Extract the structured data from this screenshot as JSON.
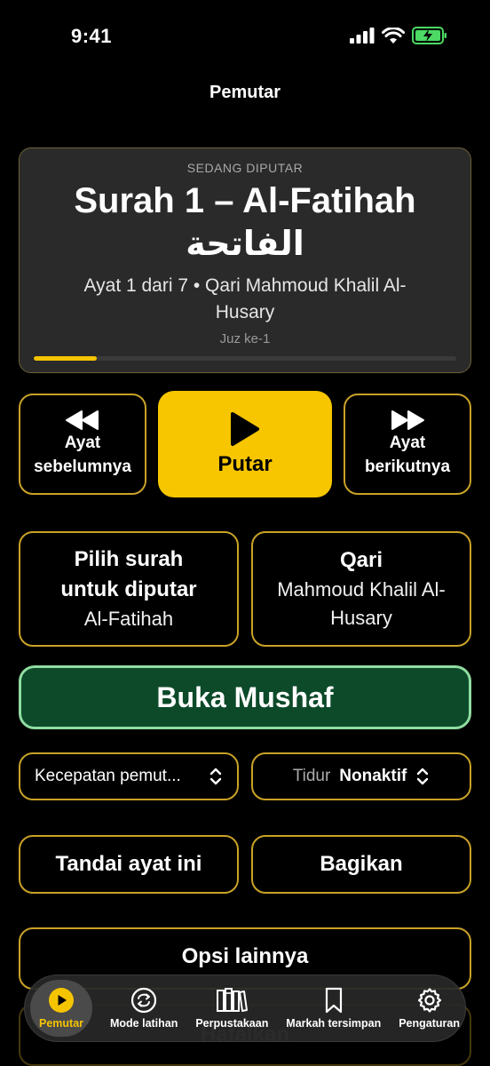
{
  "status": {
    "time": "9:41"
  },
  "nav": {
    "title": "Pemutar"
  },
  "now_playing": {
    "label": "SEDANG DIPUTAR",
    "title": "Surah 1 – Al-Fatihah",
    "arabic": "الفاتحة",
    "meta": "Ayat 1 dari 7  •  Qari Mahmoud Khalil Al-Husary",
    "juz": "Juz ke-1",
    "progress": 0.15
  },
  "controls": {
    "prev_line1": "Ayat",
    "prev_line2": "sebelumnya",
    "play": "Putar",
    "next_line1": "Ayat",
    "next_line2": "berikutnya"
  },
  "surah_picker": {
    "title_line1": "Pilih surah",
    "title_line2": "untuk diputar",
    "value": "Al-Fatihah"
  },
  "qari_picker": {
    "title": "Qari",
    "value": "Mahmoud Khalil Al-Husary"
  },
  "mushaf_button": "Buka Mushaf",
  "speed_select": {
    "value": "Kecepatan pemut..."
  },
  "sleep_select": {
    "label": "Tidur",
    "value": "Nonaktif"
  },
  "actions": {
    "bookmark": "Tandai ayat ini",
    "share": "Bagikan",
    "more": "Opsi lainnya",
    "hidden": "Hafalkan"
  },
  "tabs": [
    {
      "label": "Pemutar",
      "icon": "play-circle-icon",
      "active": true
    },
    {
      "label": "Mode latihan",
      "icon": "repeat-icon",
      "active": false
    },
    {
      "label": "Perpustakaan",
      "icon": "books-icon",
      "active": false
    },
    {
      "label": "Markah tersimpan",
      "icon": "bookmark-icon",
      "active": false
    },
    {
      "label": "Pengaturan",
      "icon": "gear-icon",
      "active": false
    }
  ],
  "colors": {
    "accent": "#f7c600",
    "mushaf_bg": "#0c4a2a",
    "mushaf_border": "#8fdca0",
    "outline": "#c9a227"
  }
}
